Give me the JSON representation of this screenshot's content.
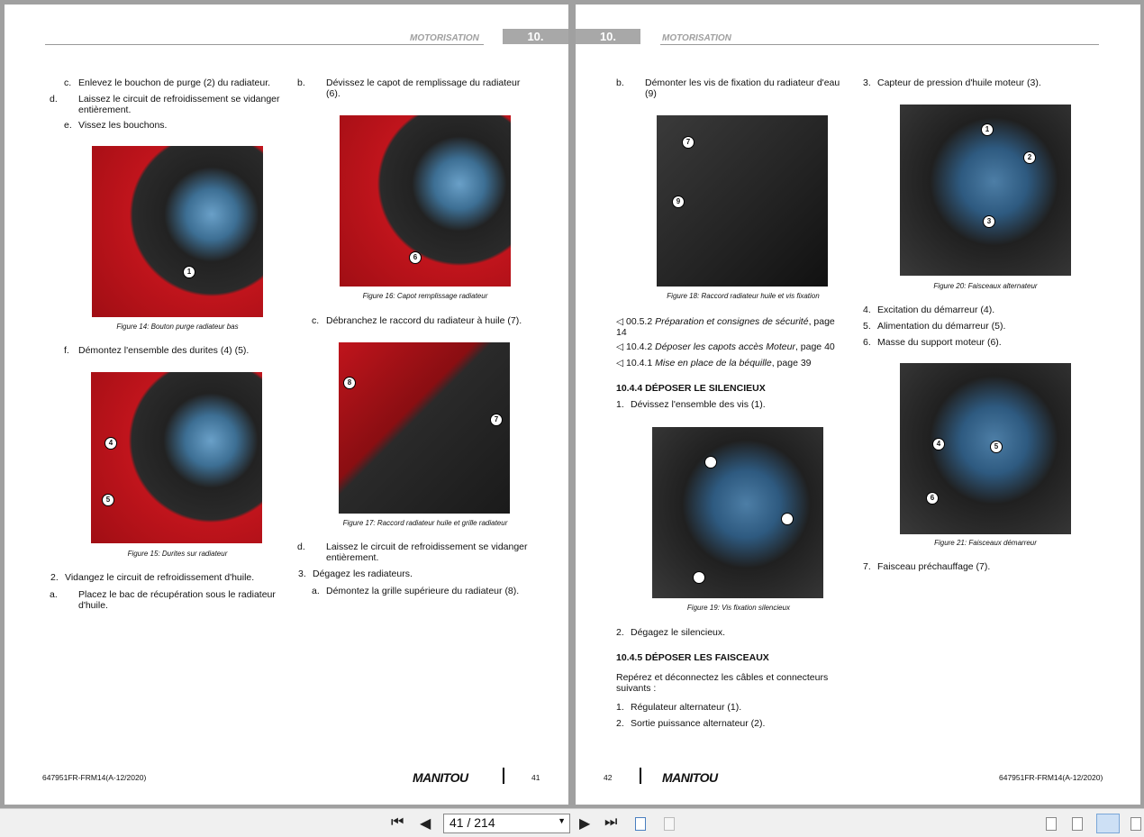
{
  "header": {
    "section": "MOTORISATION",
    "chapter": "10."
  },
  "left": {
    "steps_top": [
      {
        "n": "c.",
        "text": "Enlevez le bouchon de purge (2) du radiateur."
      },
      {
        "n": "d.",
        "text": "Laissez le circuit de refroidissement se vidanger entièrement."
      },
      {
        "n": "e.",
        "text": "Vissez les bouchons."
      }
    ],
    "fig14": {
      "caption": "Figure 14: Bouton purge radiateur bas",
      "callouts": [
        "1"
      ]
    },
    "step_f": {
      "n": "f.",
      "text": "Démontez l'ensemble des durites (4) (5)."
    },
    "fig15": {
      "caption": "Figure 15: Durites sur radiateur",
      "callouts": [
        "4",
        "5"
      ]
    },
    "step2": {
      "n": "2.",
      "text": "Vidangez le circuit de refroidissement d'huile."
    },
    "step2a": {
      "n": "a.",
      "text": "Placez le bac de récupération sous le radiateur d'huile."
    },
    "step_b": {
      "n": "b.",
      "text": "Dévissez le capot de remplissage du radiateur (6)."
    },
    "fig16": {
      "caption": "Figure 16: Capot remplissage radiateur",
      "callouts": [
        "6"
      ]
    },
    "step_c": {
      "n": "c.",
      "text": "Débranchez le raccord du radiateur à huile (7)."
    },
    "fig17": {
      "caption": "Figure 17: Raccord radiateur huile et grille radiateur",
      "callouts": [
        "8",
        "7"
      ]
    },
    "step_d": {
      "n": "d.",
      "text": "Laissez le circuit de refroidissement se vidanger entièrement."
    },
    "step3": {
      "n": "3.",
      "text": "Dégagez les radiateurs."
    },
    "step3a": {
      "n": "a.",
      "text": "Démontez la grille supérieure du radiateur (8)."
    },
    "footer": {
      "doc": "647951FR-FRM14(A-12/2020)",
      "brand": "MANITOU",
      "page": "41"
    }
  },
  "right": {
    "step_b": {
      "n": "b.",
      "text": "Démonter les vis de fixation du radiateur d'eau (9)"
    },
    "fig18": {
      "caption": "Figure 18: Raccord radiateur huile et vis fixation",
      "callouts": [
        "7",
        "9"
      ]
    },
    "refs": [
      {
        "num": "00.5.2",
        "title": "Préparation et consignes de sécurité",
        "page": ", page 14"
      },
      {
        "num": "10.4.2",
        "title": "Déposer les capots accès Moteur",
        "page": ", page 40"
      },
      {
        "num": "10.4.1",
        "title": "Mise en place de la béquille",
        "page": ", page 39"
      }
    ],
    "h1044": "10.4.4 DÉPOSER LE SILENCIEUX",
    "s1": {
      "n": "1.",
      "text": "Dévissez l'ensemble des vis (1)."
    },
    "fig19": {
      "caption": "Figure 19: Vis fixation silencieux"
    },
    "s2": {
      "n": "2.",
      "text": "Dégagez le silencieux."
    },
    "h1045": "10.4.5 DÉPOSER LES FAISCEAUX",
    "intro": "Repérez et déconnectez les câbles et connecteurs suivants :",
    "list1": [
      {
        "n": "1.",
        "text": "Régulateur alternateur (1)."
      },
      {
        "n": "2.",
        "text": "Sortie puissance alternateur (2)."
      }
    ],
    "list3": {
      "n": "3.",
      "text": "Capteur de pression d'huile moteur (3)."
    },
    "fig20": {
      "caption": "Figure 20: Faisceaux alternateur",
      "callouts": [
        "1",
        "2",
        "3"
      ]
    },
    "list4": [
      {
        "n": "4.",
        "text": "Excitation du démarreur (4)."
      },
      {
        "n": "5.",
        "text": "Alimentation du démarreur (5)."
      },
      {
        "n": "6.",
        "text": "Masse du support moteur (6)."
      }
    ],
    "fig21": {
      "caption": "Figure 21: Faisceaux démarreur",
      "callouts": [
        "4",
        "5",
        "6"
      ]
    },
    "list7": {
      "n": "7.",
      "text": "Faisceau préchauffage (7)."
    },
    "footer": {
      "doc": "647951FR-FRM14(A-12/2020)",
      "brand": "MANITOU",
      "page": "42"
    }
  },
  "toolbar": {
    "page_field": "41 / 214"
  }
}
